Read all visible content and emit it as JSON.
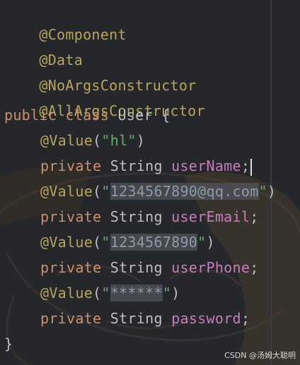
{
  "editor": {
    "lines": {
      "l1": {
        "annotation": "@Component"
      },
      "l2": {
        "annotation": "@Data"
      },
      "l3": {
        "annotation": "@NoArgsConstructor"
      },
      "l4": {
        "annotation": "@AllArgsConstructor"
      },
      "l5": {
        "kw1": "public",
        "kw2": "class",
        "name": "User",
        "brace": "{"
      },
      "l6": {
        "annotation": "@Value",
        "open": "(",
        "string": "\"hl\"",
        "close": ")"
      },
      "l7": {
        "kw": "private",
        "type": "String",
        "field": "userName",
        "semi": ";"
      },
      "l8": {
        "annotation": "@Value",
        "open": "(",
        "q1": "\"",
        "string": "1234567890@qq.com",
        "q2": "\"",
        "close": ")"
      },
      "l9": {
        "kw": "private",
        "type": "String",
        "field": "userEmail",
        "semi": ";"
      },
      "l10": {
        "annotation": "@Value",
        "open": "(",
        "q1": "\"",
        "string": "1234567890",
        "q2": "\"",
        "close": ")"
      },
      "l11": {
        "kw": "private",
        "type": "String",
        "field": "userPhone",
        "semi": ";"
      },
      "l12": {
        "annotation": "@Value",
        "open": "(",
        "q1": "\"",
        "string": "******",
        "q2": "\"",
        "close": ")"
      },
      "l13": {
        "kw": "private",
        "type": "String",
        "field": "password",
        "semi": ";"
      },
      "l14": {
        "brace": "}"
      }
    }
  },
  "watermark": "CSDN @汤姆大聪明",
  "colors": {
    "background": "#26272b",
    "annotation": "#b8a55a",
    "keyword": "#cf8e6d",
    "field": "#c77dbb",
    "string": "#6aab73",
    "text": "#bcbec4"
  }
}
